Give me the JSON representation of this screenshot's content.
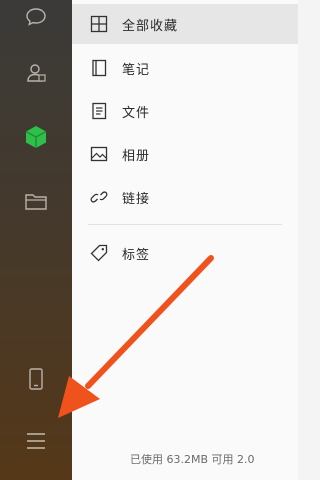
{
  "sidebar": {
    "icons": [
      "chat-icon",
      "contacts-icon",
      "favorites-cube-icon",
      "folder-icon",
      "phone-icon",
      "menu-icon"
    ],
    "accent": "#2fbf4a"
  },
  "menu": {
    "items": [
      {
        "label": "全部收藏",
        "icon": "grid-icon",
        "selected": true
      },
      {
        "label": "笔记",
        "icon": "notebook-icon"
      },
      {
        "label": "文件",
        "icon": "file-icon"
      },
      {
        "label": "相册",
        "icon": "image-icon"
      },
      {
        "label": "链接",
        "icon": "link-icon"
      },
      {
        "label": "标签",
        "icon": "tag-icon"
      }
    ]
  },
  "footer": {
    "storage_text": "已使用 63.2MB 可用 2.0"
  },
  "annotation": {
    "arrow_color": "#f0521e"
  }
}
